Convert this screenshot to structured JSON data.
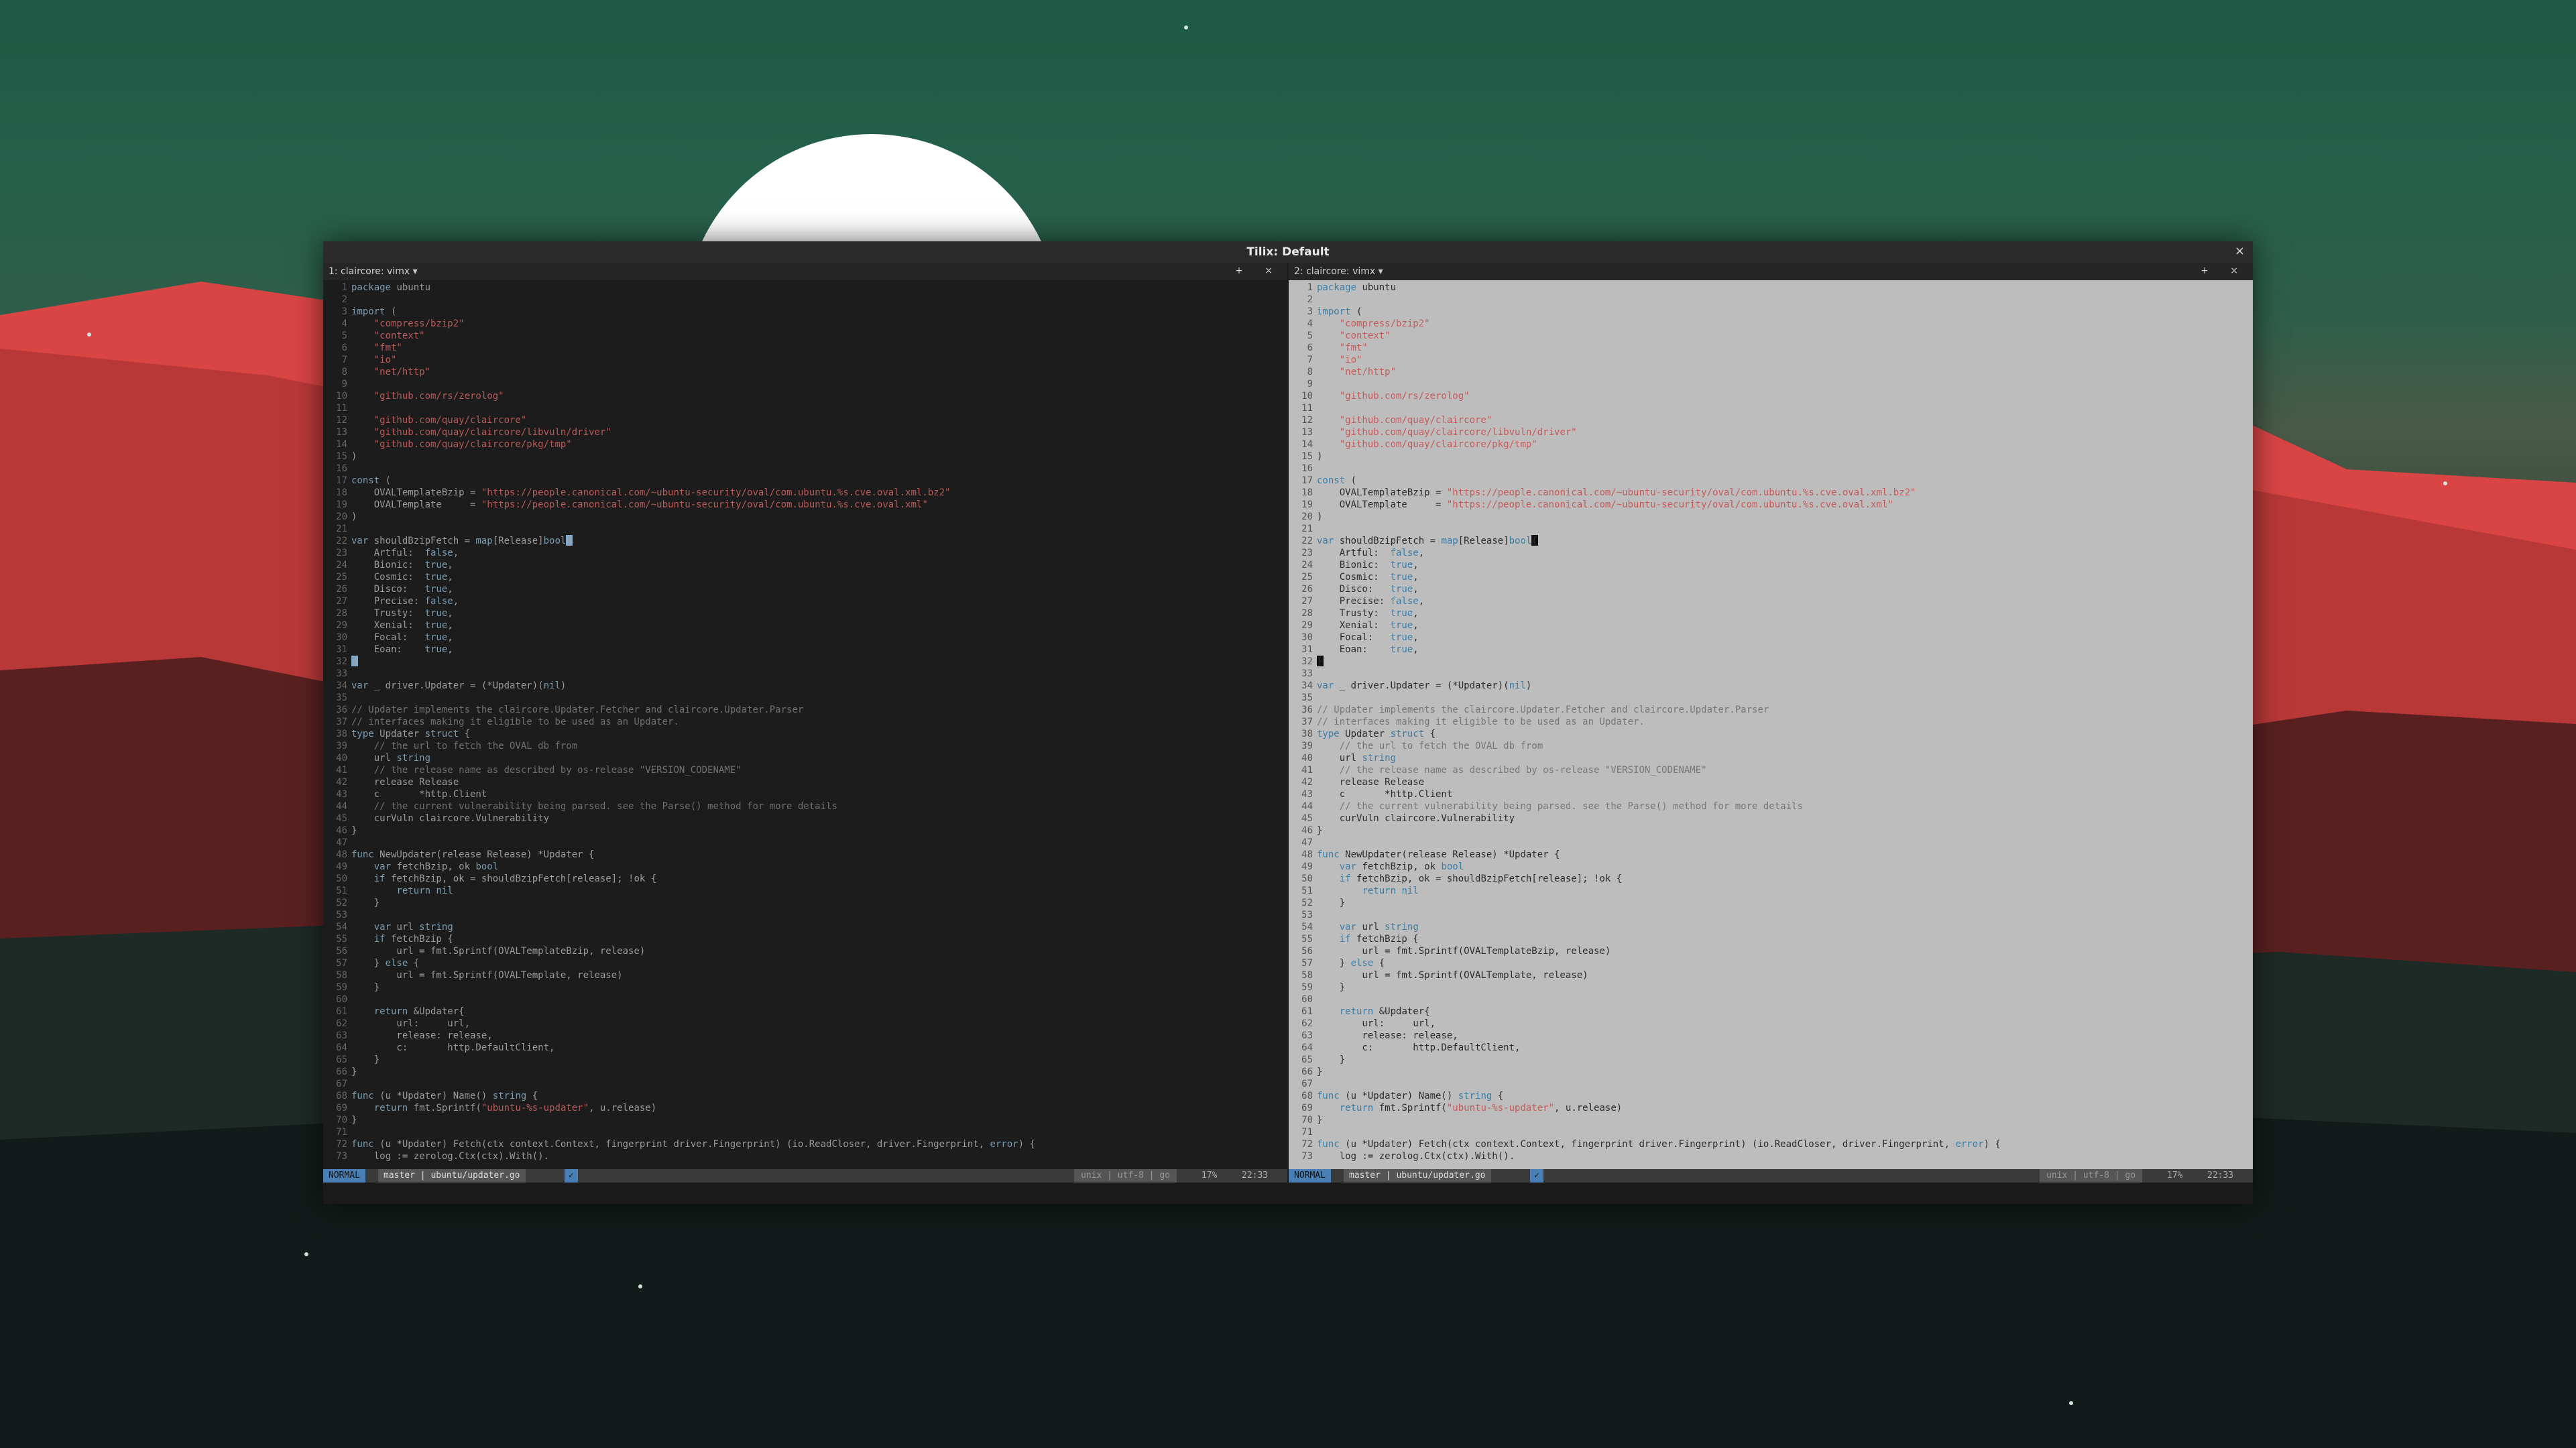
{
  "window": {
    "title": "Tilix: Default",
    "close_glyph": "×"
  },
  "panes": [
    {
      "title": "1: claircore: vimx ▾",
      "buttons": "+ ×",
      "status": {
        "mode": "NORMAL",
        "branch": "master | ubuntu/updater.go",
        "check": "✓",
        "encoding": "unix | utf-8 | go",
        "percent": "17%",
        "position": "22:33"
      }
    },
    {
      "title": "2: claircore: vimx ▾",
      "buttons": "+ ×",
      "status": {
        "mode": "NORMAL",
        "branch": "master | ubuntu/updater.go",
        "check": "✓",
        "encoding": "unix | utf-8 | go",
        "percent": "17%",
        "position": "22:33"
      }
    }
  ],
  "code_lines": [
    [
      [
        "kw",
        "package"
      ],
      [
        "t",
        " ubuntu"
      ]
    ],
    [],
    [
      [
        "kw",
        "import"
      ],
      [
        "t",
        " ("
      ]
    ],
    [
      [
        "t",
        "    "
      ],
      [
        "str",
        "\"compress/bzip2\""
      ]
    ],
    [
      [
        "t",
        "    "
      ],
      [
        "str",
        "\"context\""
      ]
    ],
    [
      [
        "t",
        "    "
      ],
      [
        "str",
        "\"fmt\""
      ]
    ],
    [
      [
        "t",
        "    "
      ],
      [
        "str",
        "\"io\""
      ]
    ],
    [
      [
        "t",
        "    "
      ],
      [
        "str",
        "\"net/http\""
      ]
    ],
    [],
    [
      [
        "t",
        "    "
      ],
      [
        "str",
        "\"github.com/rs/zerolog\""
      ]
    ],
    [],
    [
      [
        "t",
        "    "
      ],
      [
        "str",
        "\"github.com/quay/claircore\""
      ]
    ],
    [
      [
        "t",
        "    "
      ],
      [
        "str",
        "\"github.com/quay/claircore/libvuln/driver\""
      ]
    ],
    [
      [
        "t",
        "    "
      ],
      [
        "str",
        "\"github.com/quay/claircore/pkg/tmp\""
      ]
    ],
    [
      [
        "t",
        ")"
      ]
    ],
    [],
    [
      [
        "kw",
        "const"
      ],
      [
        "t",
        " ("
      ]
    ],
    [
      [
        "t",
        "    OVALTemplateBzip = "
      ],
      [
        "str",
        "\"https://people.canonical.com/~ubuntu-security/oval/com.ubuntu.%s.cve.oval.xml.bz2\""
      ]
    ],
    [
      [
        "t",
        "    OVALTemplate     = "
      ],
      [
        "str",
        "\"https://people.canonical.com/~ubuntu-security/oval/com.ubuntu.%s.cve.oval.xml\""
      ]
    ],
    [
      [
        "t",
        ")"
      ]
    ],
    [],
    [
      [
        "kw",
        "var"
      ],
      [
        "t",
        " shouldBzipFetch = "
      ],
      [
        "kw",
        "map"
      ],
      [
        "t",
        "[Release]"
      ],
      [
        "kw",
        "bool"
      ],
      [
        "cur",
        "{"
      ]
    ],
    [
      [
        "t",
        "    Artful:  "
      ],
      [
        "kw",
        "false"
      ],
      [
        "t",
        ","
      ]
    ],
    [
      [
        "t",
        "    Bionic:  "
      ],
      [
        "kw",
        "true"
      ],
      [
        "t",
        ","
      ]
    ],
    [
      [
        "t",
        "    Cosmic:  "
      ],
      [
        "kw",
        "true"
      ],
      [
        "t",
        ","
      ]
    ],
    [
      [
        "t",
        "    Disco:   "
      ],
      [
        "kw",
        "true"
      ],
      [
        "t",
        ","
      ]
    ],
    [
      [
        "t",
        "    Precise: "
      ],
      [
        "kw",
        "false"
      ],
      [
        "t",
        ","
      ]
    ],
    [
      [
        "t",
        "    Trusty:  "
      ],
      [
        "kw",
        "true"
      ],
      [
        "t",
        ","
      ]
    ],
    [
      [
        "t",
        "    Xenial:  "
      ],
      [
        "kw",
        "true"
      ],
      [
        "t",
        ","
      ]
    ],
    [
      [
        "t",
        "    Focal:   "
      ],
      [
        "kw",
        "true"
      ],
      [
        "t",
        ","
      ]
    ],
    [
      [
        "t",
        "    Eoan:    "
      ],
      [
        "kw",
        "true"
      ],
      [
        "t",
        ","
      ]
    ],
    [
      [
        "cur",
        "}"
      ]
    ],
    [],
    [
      [
        "kw",
        "var"
      ],
      [
        "t",
        " _ driver.Updater = (*Updater)("
      ],
      [
        "kw",
        "nil"
      ],
      [
        "t",
        ")"
      ]
    ],
    [],
    [
      [
        "cm",
        "// Updater implements the claircore.Updater.Fetcher and claircore.Updater.Parser"
      ]
    ],
    [
      [
        "cm",
        "// interfaces making it eligible to be used as an Updater."
      ]
    ],
    [
      [
        "kw",
        "type"
      ],
      [
        "t",
        " Updater "
      ],
      [
        "kw",
        "struct"
      ],
      [
        "t",
        " {"
      ]
    ],
    [
      [
        "t",
        "    "
      ],
      [
        "cm",
        "// the url to fetch the OVAL db from"
      ]
    ],
    [
      [
        "t",
        "    url "
      ],
      [
        "kw",
        "string"
      ]
    ],
    [
      [
        "t",
        "    "
      ],
      [
        "cm",
        "// the release name as described by os-release \"VERSION_CODENAME\""
      ]
    ],
    [
      [
        "t",
        "    release Release"
      ]
    ],
    [
      [
        "t",
        "    c       *http.Client"
      ]
    ],
    [
      [
        "t",
        "    "
      ],
      [
        "cm",
        "// the current vulnerability being parsed. see the Parse() method for more details"
      ]
    ],
    [
      [
        "t",
        "    curVuln claircore.Vulnerability"
      ]
    ],
    [
      [
        "t",
        "}"
      ]
    ],
    [],
    [
      [
        "kw",
        "func"
      ],
      [
        "t",
        " NewUpdater(release Release) *Updater {"
      ]
    ],
    [
      [
        "t",
        "    "
      ],
      [
        "kw",
        "var"
      ],
      [
        "t",
        " fetchBzip, ok "
      ],
      [
        "kw",
        "bool"
      ]
    ],
    [
      [
        "t",
        "    "
      ],
      [
        "kw",
        "if"
      ],
      [
        "t",
        " fetchBzip, ok = shouldBzipFetch[release]; !ok {"
      ]
    ],
    [
      [
        "t",
        "        "
      ],
      [
        "kw",
        "return nil"
      ]
    ],
    [
      [
        "t",
        "    }"
      ]
    ],
    [],
    [
      [
        "t",
        "    "
      ],
      [
        "kw",
        "var"
      ],
      [
        "t",
        " url "
      ],
      [
        "kw",
        "string"
      ]
    ],
    [
      [
        "t",
        "    "
      ],
      [
        "kw",
        "if"
      ],
      [
        "t",
        " fetchBzip {"
      ]
    ],
    [
      [
        "t",
        "        url = fmt.Sprintf(OVALTemplateBzip, release)"
      ]
    ],
    [
      [
        "t",
        "    } "
      ],
      [
        "kw",
        "else"
      ],
      [
        "t",
        " {"
      ]
    ],
    [
      [
        "t",
        "        url = fmt.Sprintf(OVALTemplate, release)"
      ]
    ],
    [
      [
        "t",
        "    }"
      ]
    ],
    [],
    [
      [
        "t",
        "    "
      ],
      [
        "kw",
        "return"
      ],
      [
        "t",
        " &Updater{"
      ]
    ],
    [
      [
        "t",
        "        url:     url,"
      ]
    ],
    [
      [
        "t",
        "        release: release,"
      ]
    ],
    [
      [
        "t",
        "        c:       http.DefaultClient,"
      ]
    ],
    [
      [
        "t",
        "    }"
      ]
    ],
    [
      [
        "t",
        "}"
      ]
    ],
    [],
    [
      [
        "kw",
        "func"
      ],
      [
        "t",
        " (u *Updater) Name() "
      ],
      [
        "kw",
        "string"
      ],
      [
        "t",
        " {"
      ]
    ],
    [
      [
        "t",
        "    "
      ],
      [
        "kw",
        "return"
      ],
      [
        "t",
        " fmt.Sprintf("
      ],
      [
        "str",
        "\"ubuntu-%s-updater\""
      ],
      [
        "t",
        ", u.release)"
      ]
    ],
    [
      [
        "t",
        "}"
      ]
    ],
    [],
    [
      [
        "kw",
        "func"
      ],
      [
        "t",
        " (u *Updater) Fetch(ctx context.Context, fingerprint driver.Fingerprint) (io.ReadCloser, driver.Fingerprint, "
      ],
      [
        "kw",
        "error"
      ],
      [
        "t",
        ") {"
      ]
    ],
    [
      [
        "t",
        "    log := zerolog.Ctx(ctx).With()."
      ]
    ]
  ],
  "colors": {
    "accent": "#4a7fb5",
    "left_bg": "#1c1c1c",
    "right_bg": "#bdbdbd"
  }
}
